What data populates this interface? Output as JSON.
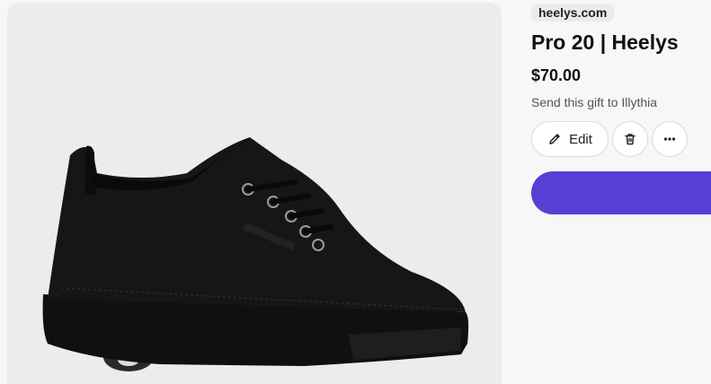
{
  "product": {
    "domain": "heelys.com",
    "title": "Pro 20 | Heelys",
    "price": "$70.00",
    "gift_text": "Send this gift to Illythia"
  },
  "actions": {
    "edit_label": "Edit",
    "edit_icon": "pencil-icon",
    "delete_icon": "trash-icon",
    "more_icon": "ellipsis-icon"
  },
  "colors": {
    "accent": "#5a3fd6",
    "image_bg": "#ececec",
    "shoe": "#141414"
  }
}
